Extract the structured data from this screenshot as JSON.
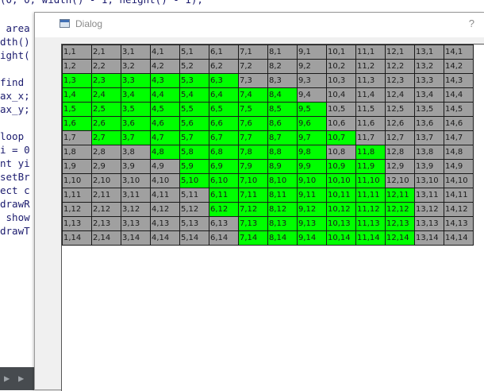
{
  "colors": {
    "green": "#00ff00",
    "gray": "#a0a0a0"
  },
  "editor": {
    "lines": [
      "(0, 0, width() - 1, height() - 1);",
      " area",
      "dth()",
      "ight(",
      "",
      "find ",
      "ax_x;",
      "ax_y;",
      "",
      "loop ",
      "i = 0",
      "nt yi",
      "setBr",
      "ect c",
      "drawR",
      " show",
      "drawT"
    ]
  },
  "dialog": {
    "title": "Dialog",
    "help": "?"
  },
  "grid": {
    "cols": 14,
    "rows": 14,
    "green_cells": {
      "3": [
        1,
        2,
        3,
        4,
        5,
        6
      ],
      "4": [
        1,
        2,
        3,
        4,
        5,
        6,
        7,
        8
      ],
      "5": [
        1,
        2,
        3,
        4,
        5,
        6,
        7,
        8,
        9
      ],
      "6": [
        1,
        2,
        3,
        4,
        5,
        6,
        7,
        8,
        9
      ],
      "7": [
        2,
        3,
        4,
        5,
        6,
        7,
        8,
        9,
        10
      ],
      "8": [
        4,
        5,
        6,
        7,
        8,
        9,
        11
      ],
      "9": [
        5,
        6,
        7,
        8,
        9,
        10,
        11
      ],
      "10": [
        5,
        6,
        7,
        8,
        9,
        10,
        11
      ],
      "11": [
        6,
        7,
        8,
        9,
        10,
        11,
        12
      ],
      "12": [
        6,
        7,
        8,
        9,
        10,
        11,
        12
      ],
      "13": [
        7,
        8,
        9,
        10,
        11,
        12
      ],
      "14": [
        7,
        8,
        9,
        10,
        11,
        12
      ]
    }
  }
}
